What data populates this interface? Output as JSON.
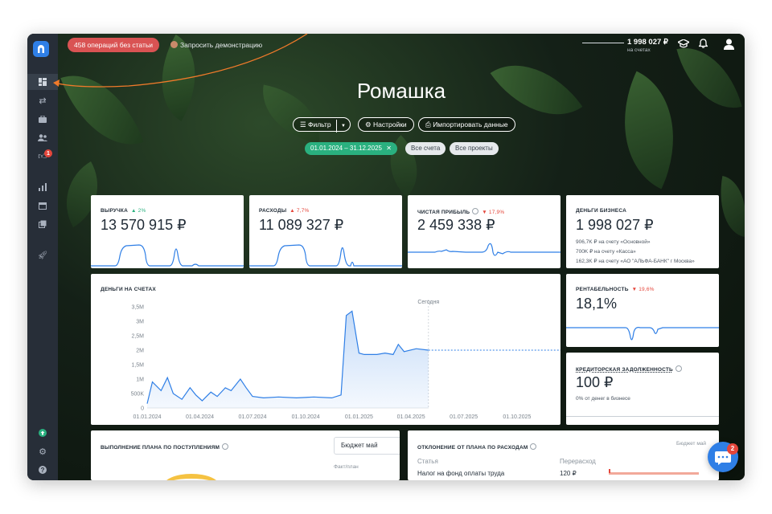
{
  "topbar": {
    "alert_pill": "458 операций без статьи",
    "demo_link": "Запросить демонстрацию",
    "balance_value": "1 998 027 ₽",
    "balance_sub": "на счетах"
  },
  "sidebar": {
    "badge_count": "1"
  },
  "page": {
    "title": "Ромашка"
  },
  "controls": {
    "filter_label": "Фильтр",
    "settings_label": "Настройки",
    "import_label": "Импортировать данные",
    "date_range": "01.01.2024 – 31.12.2025",
    "accounts_chip": "Все счета",
    "projects_chip": "Все проекты"
  },
  "kpis": {
    "revenue": {
      "label": "ВЫРУЧКА",
      "delta": "▲ 2%",
      "value": "13 570 915 ₽"
    },
    "expenses": {
      "label": "РАСХОДЫ",
      "delta": "▲ 7,7%",
      "value": "11 089 327 ₽"
    },
    "profit": {
      "label": "ЧИСТАЯ ПРИБЫЛЬ",
      "delta": "▼ 17,9%",
      "value": "2 459 338 ₽"
    },
    "business_money": {
      "label": "ДЕНЬГИ БИЗНЕСА",
      "value": "1 998 027 ₽",
      "line1": "906,7K ₽ на счету «Основной»",
      "line2": "700K ₽ на счету «Касса»",
      "line3": "162,3K ₽ на счету «АО \"АЛЬФА-БАНК\" г Москва»"
    },
    "profitability": {
      "label": "РЕНТАБЕЛЬНОСТЬ",
      "delta": "▼ 19,6%",
      "value": "18,1%"
    },
    "payables": {
      "label": "КРЕДИТОРСКАЯ ЗАДОЛЖЕННОСТЬ",
      "value": "100 ₽",
      "sub": "0% от денег в бизнесе"
    }
  },
  "cash_chart": {
    "title": "ДЕНЬГИ НА СЧЕТАХ",
    "today_label": "Сегодня"
  },
  "chart_data": {
    "type": "area",
    "title": "ДЕНЬГИ НА СЧЕТАХ",
    "xlabel": "",
    "ylabel": "",
    "y_ticks": [
      "0",
      "500K",
      "1M",
      "1,5M",
      "2M",
      "2,5M",
      "3M",
      "3,5M"
    ],
    "x_ticks": [
      "01.01.2024",
      "01.04.2024",
      "01.07.2024",
      "01.10.2024",
      "01.01.2025",
      "01.04.2025",
      "01.07.2025",
      "01.10.2025"
    ],
    "ylim": [
      0,
      3500000
    ],
    "series": [
      {
        "values_kind": "actual",
        "x": [
          "2024-01-01",
          "2024-01-10",
          "2024-01-25",
          "2024-02-05",
          "2024-02-15",
          "2024-03-01",
          "2024-03-15",
          "2024-03-25",
          "2024-04-05",
          "2024-04-20",
          "2024-05-01",
          "2024-05-15",
          "2024-05-25",
          "2024-06-10",
          "2024-06-20",
          "2024-07-01",
          "2024-07-20",
          "2024-08-15",
          "2024-09-15",
          "2024-10-15",
          "2024-11-15",
          "2024-12-01",
          "2024-12-10",
          "2024-12-20",
          "2025-01-01",
          "2025-01-10",
          "2025-02-01",
          "2025-02-15",
          "2025-03-01",
          "2025-03-10",
          "2025-03-20",
          "2025-04-10",
          "2025-05-01"
        ],
        "values": [
          150000,
          900000,
          600000,
          1050000,
          500000,
          300000,
          700000,
          450000,
          250000,
          550000,
          400000,
          700000,
          600000,
          1000000,
          700000,
          400000,
          350000,
          380000,
          350000,
          380000,
          350000,
          450000,
          3200000,
          3350000,
          1900000,
          1850000,
          1850000,
          1900000,
          1850000,
          2200000,
          1950000,
          2050000,
          2000000
        ]
      },
      {
        "values_kind": "forecast",
        "x": [
          "2025-05-01",
          "2025-12-31"
        ],
        "values": [
          2000000,
          2000000
        ]
      }
    ],
    "annotations": [
      "Сегодня"
    ]
  },
  "plan_income": {
    "title": "ВЫПОЛНЕНИЕ ПЛАНА ПО ПОСТУПЛЕНИЯМ",
    "dropdown": "Бюджет май",
    "sub": "Факт/план"
  },
  "plan_expenses": {
    "title": "ОТКЛОНЕНИЕ ОТ ПЛАНА ПО РАСХОДАМ",
    "budget": "Бюджет май",
    "col_article": "Статья",
    "col_overspend": "Перерасход",
    "row1_article": "Налог на фонд оплаты труда",
    "row1_value": "120 ₽"
  },
  "chat": {
    "badge": "2"
  },
  "colors": {
    "accent": "#2f7fe6",
    "alert": "#d95353",
    "success": "#2ab07f",
    "sidebar": "#272e38"
  }
}
